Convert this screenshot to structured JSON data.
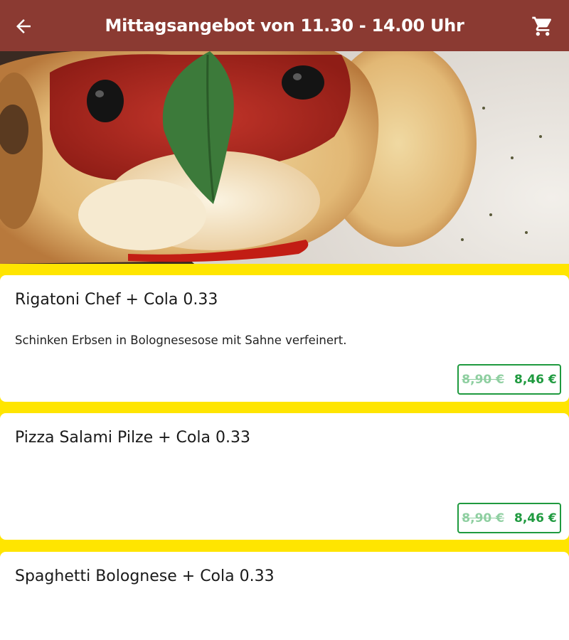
{
  "header": {
    "title": "Mittagsangebot von 11.30 - 14.00 Uhr",
    "back_icon": "arrow-left-icon",
    "cart_icon": "shopping-cart-icon",
    "background_color": "#8b3a32"
  },
  "hero": {
    "image": "pizza-calzone-photo"
  },
  "items": [
    {
      "name": "Rigatoni Chef + Cola 0.33",
      "description": "Schinken Erbsen in Bolognesesose mit Sahne verfeinert.",
      "old_price": "8,90 €",
      "new_price": "8,46 €"
    },
    {
      "name": "Pizza Salami Pilze + Cola 0.33",
      "description": "",
      "old_price": "8,90 €",
      "new_price": "8,46 €"
    },
    {
      "name": "Spaghetti Bolognese + Cola 0.33",
      "description": ""
    }
  ],
  "colors": {
    "list_background": "#ffe500",
    "price_green": "#1f9a3f",
    "price_strike": "#8fcfa1"
  }
}
